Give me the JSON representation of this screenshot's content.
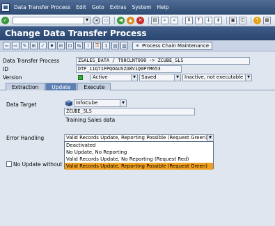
{
  "menubar": {
    "items": [
      "Data Transfer Process",
      "Edit",
      "Goto",
      "Extras",
      "System",
      "Help"
    ]
  },
  "title": "Change Data Transfer Process",
  "app_toolbar": {
    "process_chain_label": "Process Chain Maintenance"
  },
  "header": {
    "dtp_label": "Data Transfer Process",
    "dtp_value": "ZSALES_DATA / T90CLNT090 -> ZCUBE_SLS",
    "id_label": "ID",
    "id_value": "DTP_11Q71FPQOAUSZU8V1Q0PYM653",
    "version_label": "Version",
    "version_value": "Active",
    "saved_value": "Saved",
    "exec_value": "Inactive, not executable"
  },
  "tabs": [
    "Extraction",
    "Update",
    "Execute"
  ],
  "update": {
    "data_target_label": "Data Target",
    "target_type": "InfoCube",
    "target_name": "ZCUBE_SLS",
    "target_desc": "Training Sales data",
    "error_handling_label": "Error Handling",
    "error_handling_value": "Valid Records Update, Reporting Possible (Request Green)",
    "error_handling_options": [
      "Deactivated",
      "No Update, No Reporting",
      "Valid Records Update, No Reporting (Request Red)",
      "Valid Records Update, Reporting Possible (Request Green)"
    ],
    "no_update_label": "No Update without Mast"
  },
  "colors": {
    "title_bar": "#2f4c75",
    "active_tab": "#5c80b2",
    "selected_option": "#f0a020",
    "status_green": "#2fb42f"
  }
}
